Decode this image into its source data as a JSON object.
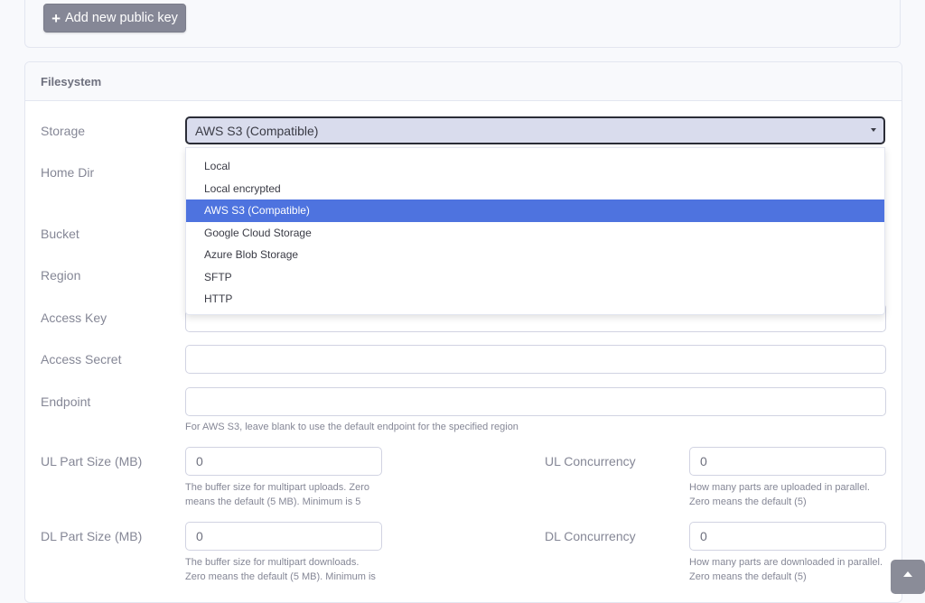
{
  "public_keys": {
    "add_button_label": "Add new public key",
    "add_icon": "plus-icon"
  },
  "filesystem": {
    "title": "Filesystem",
    "storage": {
      "label": "Storage",
      "selected": "AWS S3 (Compatible)",
      "options": [
        "Local",
        "Local encrypted",
        "AWS S3 (Compatible)",
        "Google Cloud Storage",
        "Azure Blob Storage",
        "SFTP",
        "HTTP"
      ],
      "selected_index": 2
    },
    "home_dir": {
      "label": "Home Dir"
    },
    "bucket": {
      "label": "Bucket"
    },
    "region": {
      "label": "Region"
    },
    "access_key": {
      "label": "Access Key",
      "value": ""
    },
    "access_secret": {
      "label": "Access Secret",
      "value": ""
    },
    "endpoint": {
      "label": "Endpoint",
      "value": "",
      "help": "For AWS S3, leave blank to use the default endpoint for the specified region"
    },
    "ul_part_size": {
      "label": "UL Part Size (MB)",
      "value": "0",
      "help_line1": "The buffer size for multipart uploads. Zero",
      "help_line2": "means the default (5 MB). Minimum is 5"
    },
    "ul_concurrency": {
      "label": "UL Concurrency",
      "value": "0",
      "help_line1": "How many parts are uploaded in parallel.",
      "help_line2": "Zero means the default (5)"
    },
    "dl_part_size": {
      "label": "DL Part Size (MB)",
      "value": "0",
      "help_line1": "The buffer size for multipart downloads.",
      "help_line2": "Zero means the default (5 MB). Minimum is"
    },
    "dl_concurrency": {
      "label": "DL Concurrency",
      "value": "0",
      "help_line1": "How many parts are downloaded in parallel.",
      "help_line2": "Zero means the default (5)"
    }
  },
  "scroll_top": {
    "icon": "chevron-up-icon"
  },
  "colors": {
    "accent": "#4e73df",
    "button_gray": "#858796",
    "text": "#858796"
  }
}
